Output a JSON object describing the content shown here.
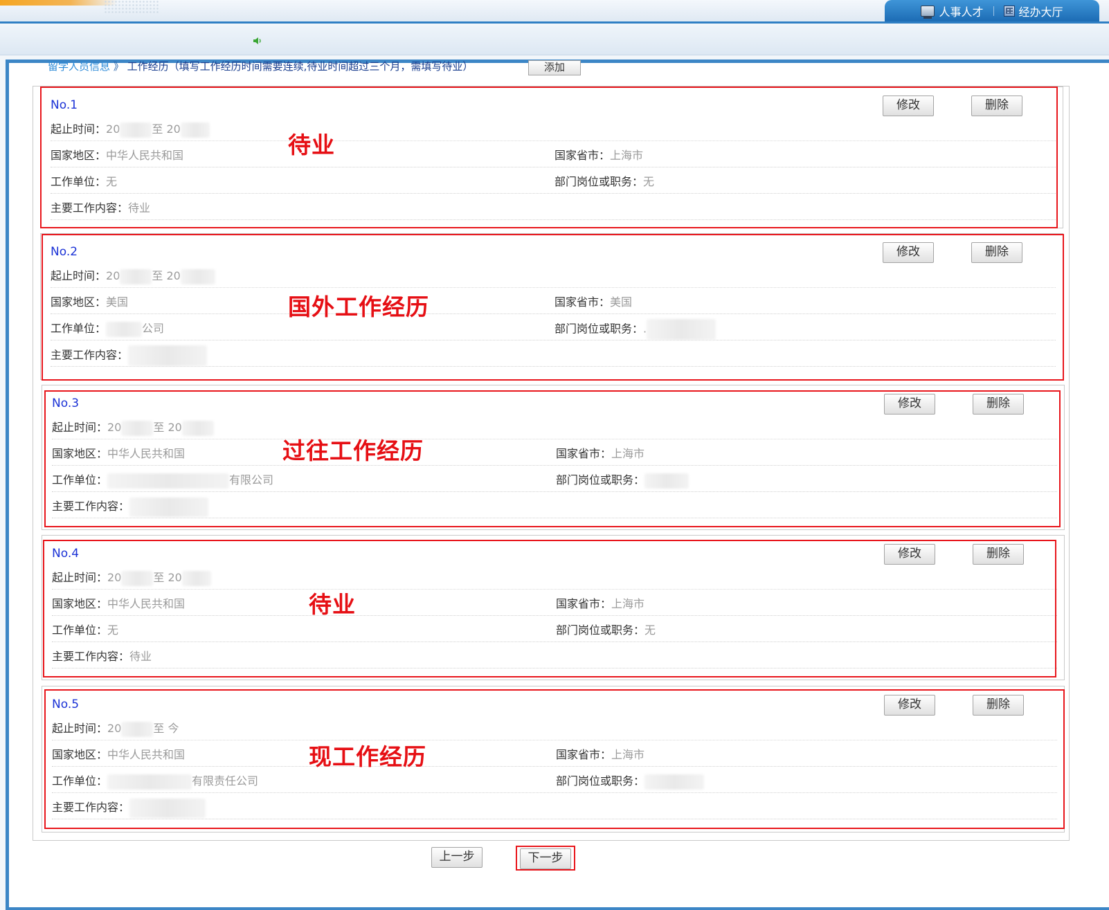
{
  "topnav": {
    "tabs": [
      {
        "label": "人事人才",
        "icon": "monitor-icon"
      },
      {
        "label": "经办大厅",
        "icon": "building-icon"
      }
    ]
  },
  "section": {
    "category": "留学人员信息",
    "title": "工作经历（填写工作经历时间需要连续,待业时间超过三个月，需填写待业）",
    "add_label": "添加"
  },
  "labels": {
    "period": "起止时间：",
    "country": "国家地区：",
    "province": "国家省市：",
    "employer": "工作单位：",
    "position": "部门岗位或职务：",
    "duties": "主要工作内容：",
    "edit": "修改",
    "delete": "删除",
    "to": "至"
  },
  "records": [
    {
      "no": "No.1",
      "start": "20",
      "end": "20",
      "country": "中华人民共和国",
      "province": "上海市",
      "employer": "无",
      "position": "无",
      "duties": "待业",
      "annotation": "待业"
    },
    {
      "no": "No.2",
      "start": "20",
      "end": "20",
      "country": "美国",
      "province": "美国",
      "employer": "公司",
      "position": ".",
      "duties": "",
      "annotation": "国外工作经历"
    },
    {
      "no": "No.3",
      "start": "20",
      "end": "20",
      "country": "中华人民共和国",
      "province": "上海市",
      "employer": "有限公司",
      "position": "",
      "duties": "",
      "annotation": "过往工作经历"
    },
    {
      "no": "No.4",
      "start": "20",
      "end": "20",
      "country": "中华人民共和国",
      "province": "上海市",
      "employer": "无",
      "position": "无",
      "duties": "待业",
      "annotation": "待业"
    },
    {
      "no": "No.5",
      "start": "20",
      "end": "今",
      "country": "中华人民共和国",
      "province": "上海市",
      "employer": "有限责任公司",
      "position": "",
      "duties": "",
      "annotation": "现工作经历"
    }
  ],
  "footer": {
    "prev_label": "上一步",
    "next_label": "下一步"
  },
  "colors": {
    "accent": "#3c86c6",
    "annotation": "#e60f14",
    "record_number": "#1b32d6"
  }
}
